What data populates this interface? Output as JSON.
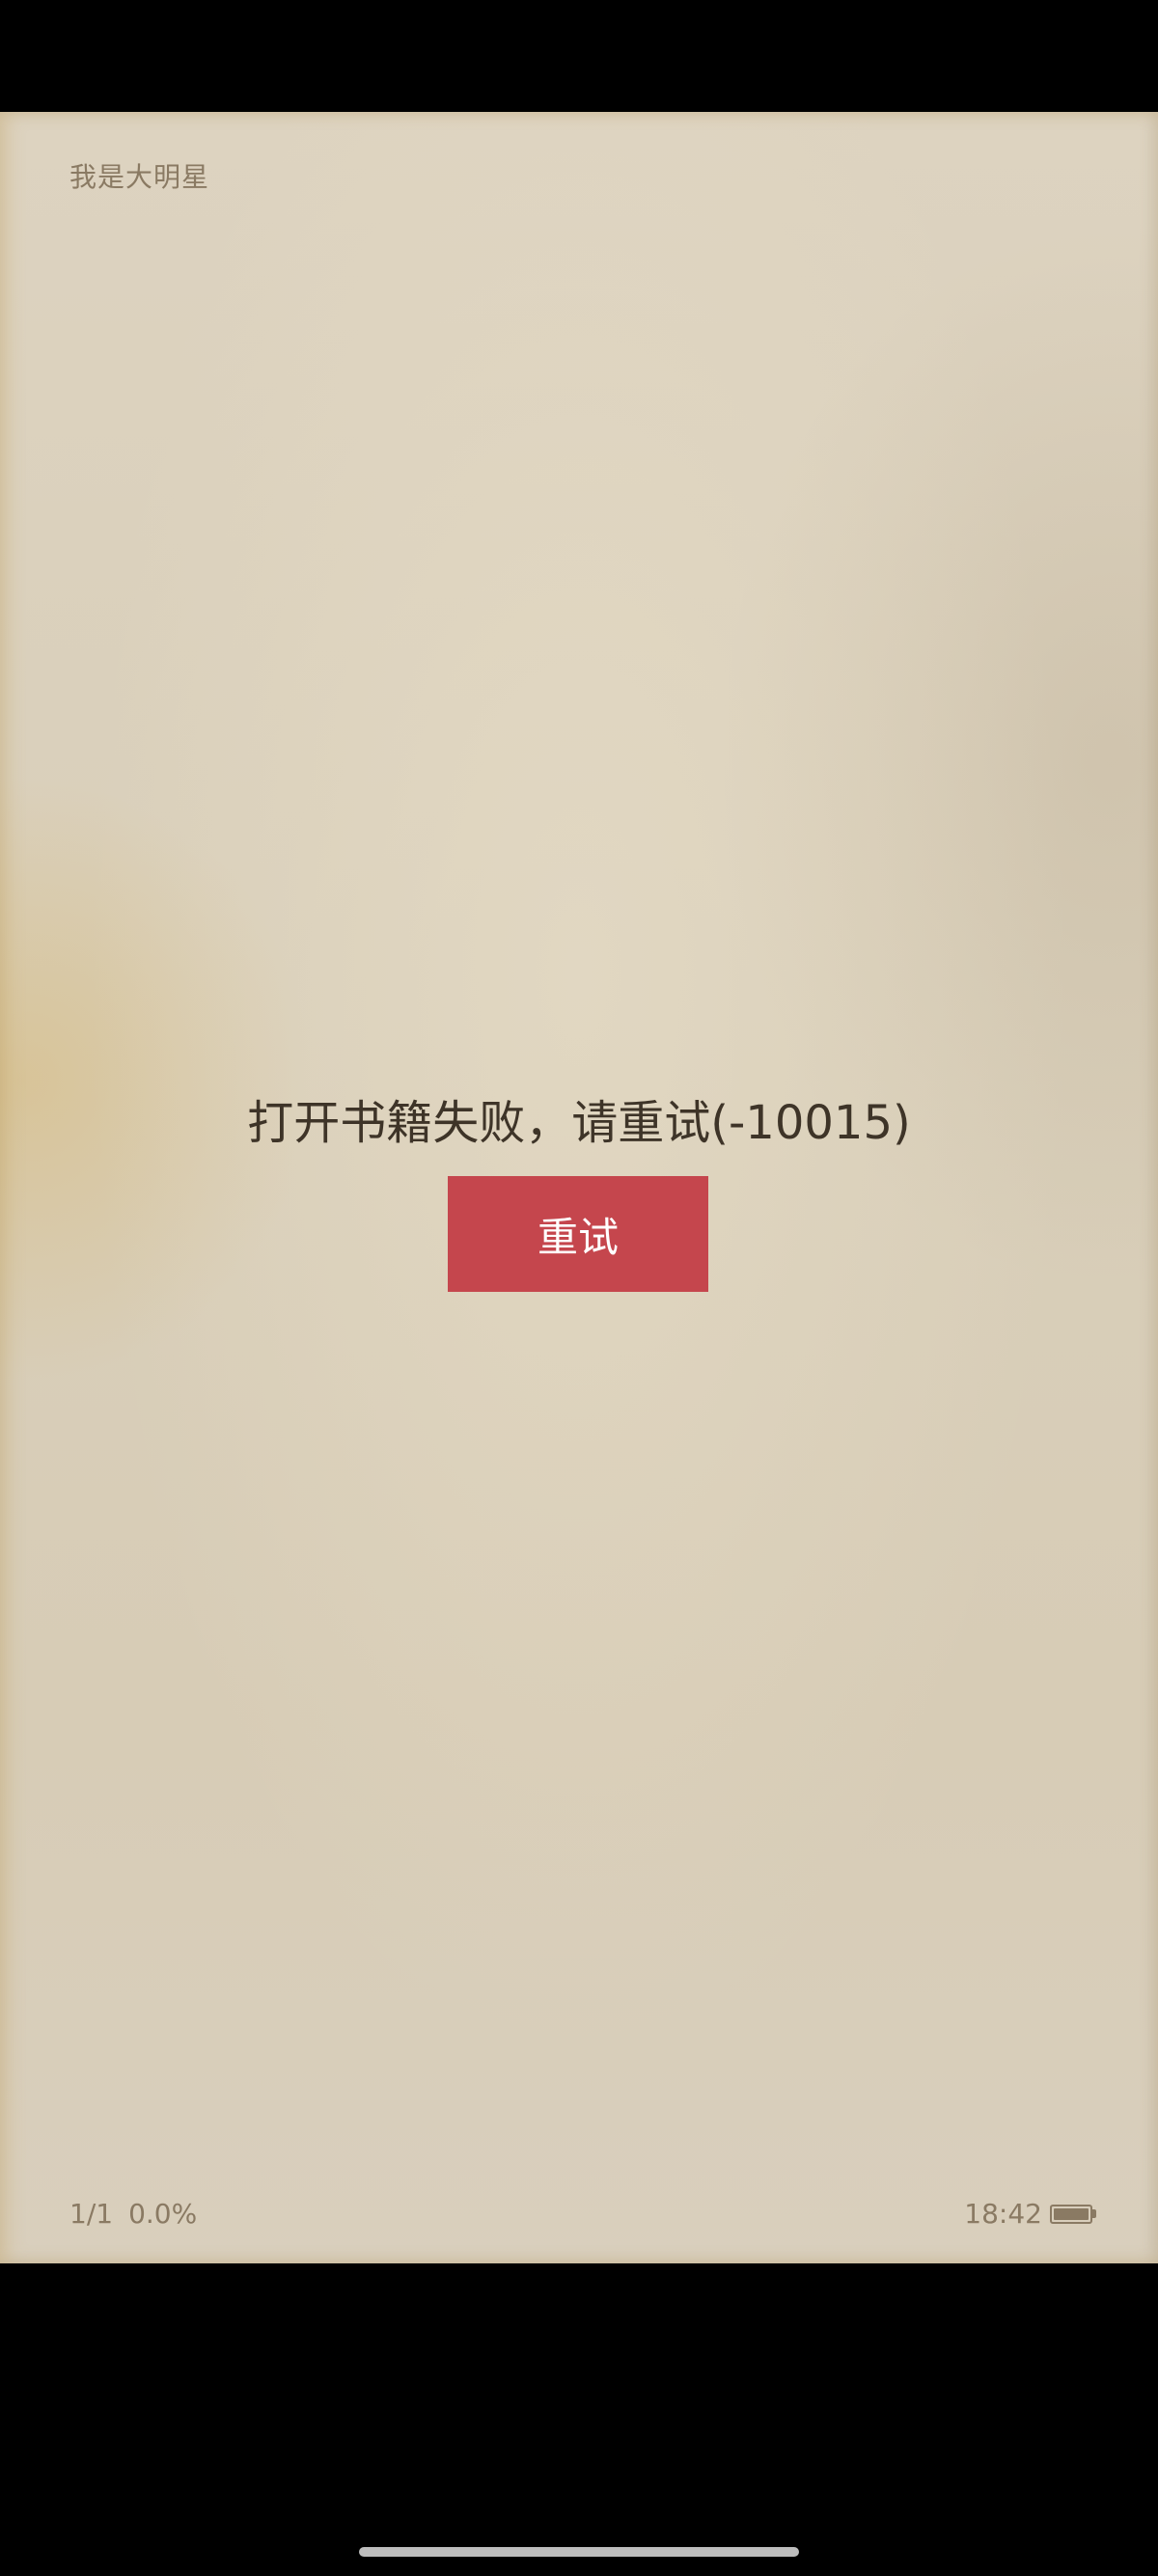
{
  "header": {
    "book_title": "我是大明星"
  },
  "error": {
    "message": "打开书籍失败，请重试(-10015)",
    "retry_label": "重试"
  },
  "footer": {
    "page_indicator": "1/1",
    "progress": "0.0%",
    "time": "18:42",
    "battery_level": 1.0
  },
  "colors": {
    "page_background": "#d9cfba",
    "secondary_text": "#8a7a63",
    "primary_text": "#3e3428",
    "retry_button": "#c5464d"
  }
}
